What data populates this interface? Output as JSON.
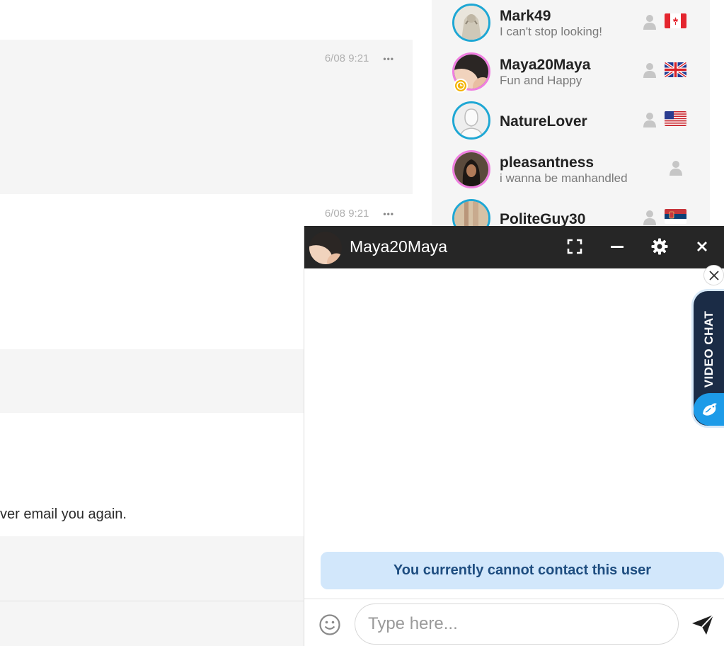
{
  "feed": {
    "messages": [
      {
        "timestamp": "6/08 9:21",
        "more": "•••"
      },
      {
        "timestamp": "6/08 9:21",
        "more": "•••"
      }
    ],
    "partial_text": "ver email you again."
  },
  "user_list": {
    "users": [
      {
        "name": "Mark49",
        "status": "I can't stop looking!",
        "flag": "Canada",
        "avatar_ring": "#1ea7d4"
      },
      {
        "name": "Maya20Maya",
        "status": "Fun and Happy",
        "flag": "United Kingdom",
        "avatar_ring": "#ef7ee0"
      },
      {
        "name": "NatureLover",
        "status": "",
        "flag": "United States",
        "avatar_ring": "#1ea7d4"
      },
      {
        "name": "pleasantness",
        "status": "i wanna be manhandled",
        "flag": "",
        "avatar_ring": "#ef7ee0"
      },
      {
        "name": "PoliteGuy30",
        "status": "",
        "flag": "Serbia",
        "avatar_ring": "#1ea7d4"
      }
    ]
  },
  "chat": {
    "title": "Maya20Maya",
    "notice": "You currently cannot contact this user",
    "input_placeholder": "Type here...",
    "header_color": "#262626",
    "notice_bg": "#d2e7fb",
    "notice_text_color": "#1e4d80"
  },
  "video_chat_tab": {
    "label": "VIDEO CHAT",
    "bg": "#1b2c46",
    "accent": "#1d9be8"
  }
}
